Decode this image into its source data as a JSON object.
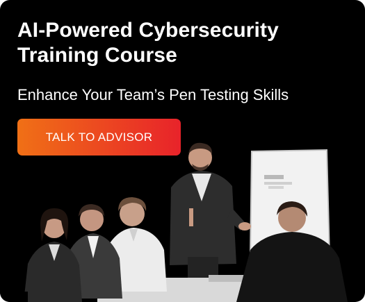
{
  "banner": {
    "title": "AI-Powered Cybersecurity Training Course",
    "subtitle": "Enhance Your Team’s Pen Testing Skills",
    "cta_label": "TALK TO ADVISOR",
    "accent_gradient": [
      "#f07016",
      "#e8232a"
    ],
    "background_color": "#000000"
  },
  "image": {
    "icon": "team-training-photo"
  }
}
